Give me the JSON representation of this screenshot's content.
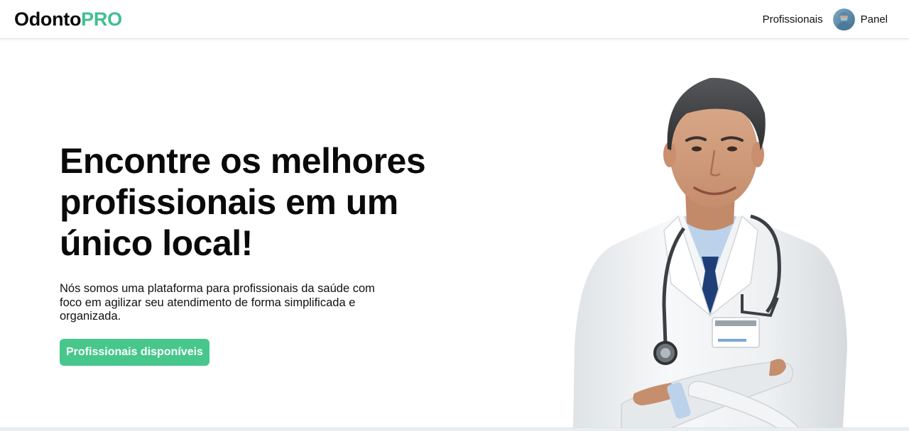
{
  "header": {
    "logo_main": "Odonto",
    "logo_accent": "PRO",
    "nav_professionals": "Profissionais",
    "nav_panel": "Panel"
  },
  "hero": {
    "title": "Encontre os melhores profissionais em um único local!",
    "description": "Nós somos uma plataforma para profissionais da saúde com foco em agilizar seu atendimento de forma simplificada e organizada.",
    "cta_label": "Profissionais disponíveis"
  },
  "colors": {
    "accent": "#3fbf8f",
    "cta_background": "#47c78b"
  }
}
